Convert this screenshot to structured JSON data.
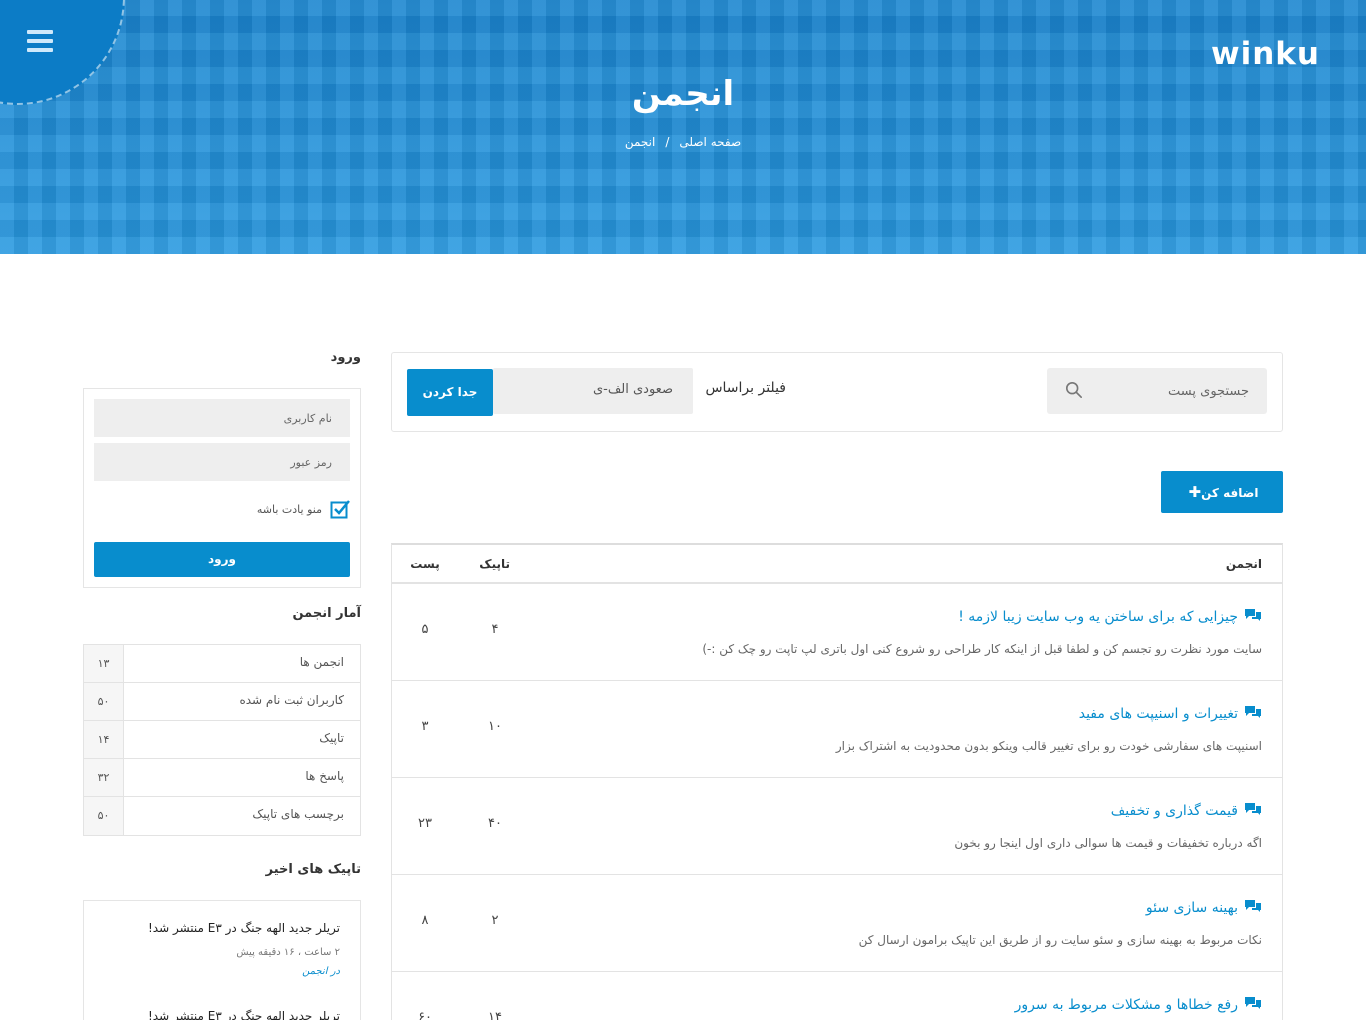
{
  "header": {
    "logo": "winku",
    "title": "انجمن",
    "breadcrumb": [
      "صفحه اصلی",
      "انجمن"
    ],
    "breadcrumb_separator": "/"
  },
  "filter": {
    "search_placeholder": "جستجوی پست",
    "filter_label": "فیلتر براساس",
    "sort_value": "صعودی الف-ی",
    "separate_button": "جدا کردن"
  },
  "add_button": "اضافه کن",
  "table": {
    "headers": {
      "forum": "انجمن",
      "topic": "تاپیک",
      "post": "پست"
    },
    "rows": [
      {
        "title": "چیزایی که برای ساختن یه وب سایت زیبا لازمه !",
        "desc": "سایت مورد نظرت رو تجسم کن و لطفا قبل از اینکه کار طراحی رو شروع کنی اول باتری لپ تاپت رو چک کن :-)",
        "topics": "۴",
        "posts": "۵"
      },
      {
        "title": "تغییرات و اسنیپت های مفید",
        "desc": "اسنیپت های سفارشی خودت رو برای تغییر قالب وینکو بدون محدودیت به اشتراک بزار",
        "topics": "۱۰",
        "posts": "۳"
      },
      {
        "title": "قیمت گذاری و تخفیف",
        "desc": "اگه درباره تخفیفات و قیمت ها سوالی داری اول اینجا رو بخون",
        "topics": "۴۰",
        "posts": "۲۳"
      },
      {
        "title": "بهینه سازی سئو",
        "desc": "نکات مربوط به بهینه سازی و سئو سایت رو از طریق این تاپیک برامون ارسال کن",
        "topics": "۲",
        "posts": "۸"
      },
      {
        "title": "رفع خطاها و مشکلات مربوط به سرور",
        "desc": "",
        "topics": "۱۴",
        "posts": "۶۰"
      }
    ]
  },
  "sidebar": {
    "login_heading": "ورود",
    "username_placeholder": "نام کاربری",
    "password_placeholder": "رمز عبور",
    "remember_label": "منو یادت باشه",
    "login_button": "ورود",
    "stats_heading": "آمار انجمن",
    "stats": [
      {
        "label": "انجمن ها",
        "value": "۱۳"
      },
      {
        "label": "کاربران ثبت نام شده",
        "value": "۵۰"
      },
      {
        "label": "تاپیک",
        "value": "۱۴"
      },
      {
        "label": "پاسخ ها",
        "value": "۳۲"
      },
      {
        "label": "برچسب های تاپیک",
        "value": "۵۰"
      }
    ],
    "recent_heading": "تاپیک های اخیر",
    "recent": [
      {
        "title": "تریلر جدید الهه جنگ در E۳ منتشر شد!",
        "time": "۲ ساعت ، ۱۶ دقیقه پیش",
        "category": "در انجمن"
      },
      {
        "title": "تریلر جدید الهه جنگ در E۳ منتشر شد!",
        "time": "",
        "category": ""
      }
    ]
  },
  "colors": {
    "primary": "#088dcd",
    "banner": "#1f8fd8"
  },
  "icons": {
    "menu": "hamburger-icon",
    "search": "search-icon",
    "topic": "comments-icon",
    "checkbox": "checkbox-checked-icon"
  }
}
